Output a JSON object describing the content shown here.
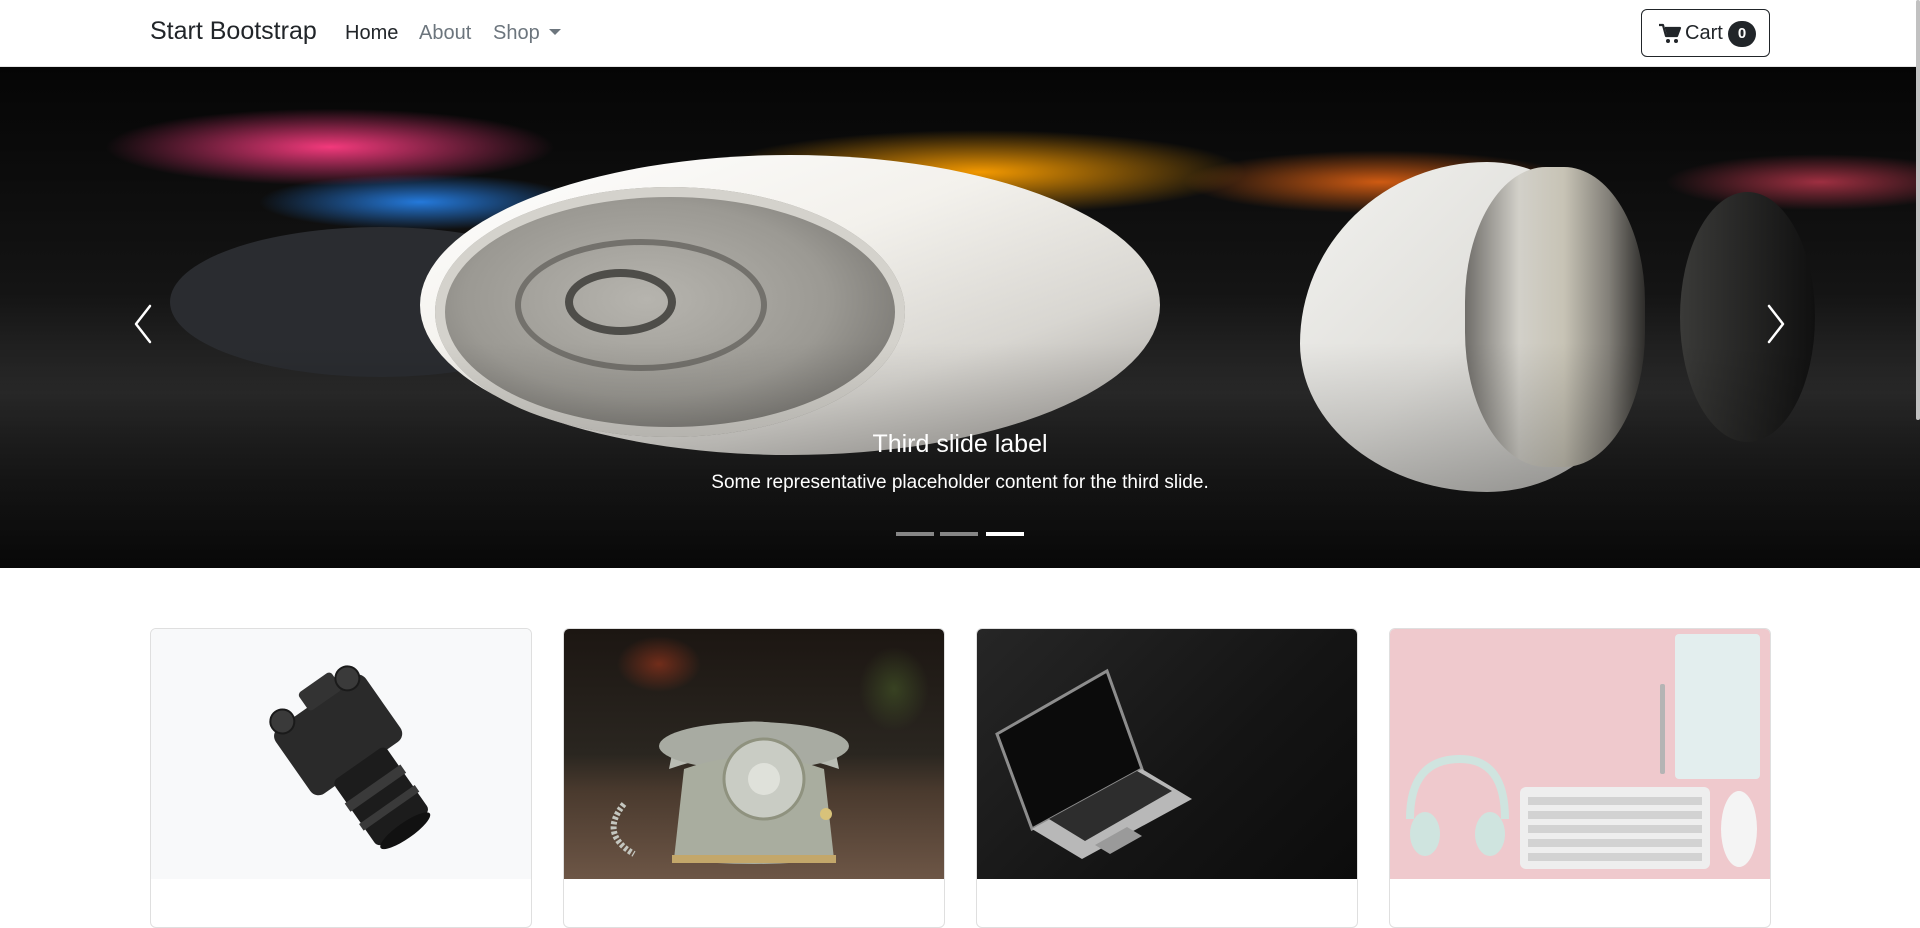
{
  "navbar": {
    "brand": "Start Bootstrap",
    "links": [
      {
        "label": "Home",
        "active": true
      },
      {
        "label": "About",
        "active": false
      },
      {
        "label": "Shop",
        "active": false
      }
    ],
    "cart": {
      "label": "Cart",
      "count": "0",
      "icon": "cart-icon"
    }
  },
  "carousel": {
    "slide_count": 3,
    "active_slide": 3,
    "caption_title": "Third slide label",
    "caption_text": "Some representative placeholder content for the third slide.",
    "controls": {
      "prev_icon": "chevron-left-icon",
      "next_icon": "chevron-right-icon"
    }
  },
  "products": [
    {
      "image": "camera"
    },
    {
      "image": "rotary telephone"
    },
    {
      "image": "laptop"
    },
    {
      "image": "headphones, keyboard, mouse and notebook on pink desk"
    }
  ],
  "colors": {
    "text": "#212529",
    "muted": "#6c757d",
    "badge": "#212529"
  }
}
